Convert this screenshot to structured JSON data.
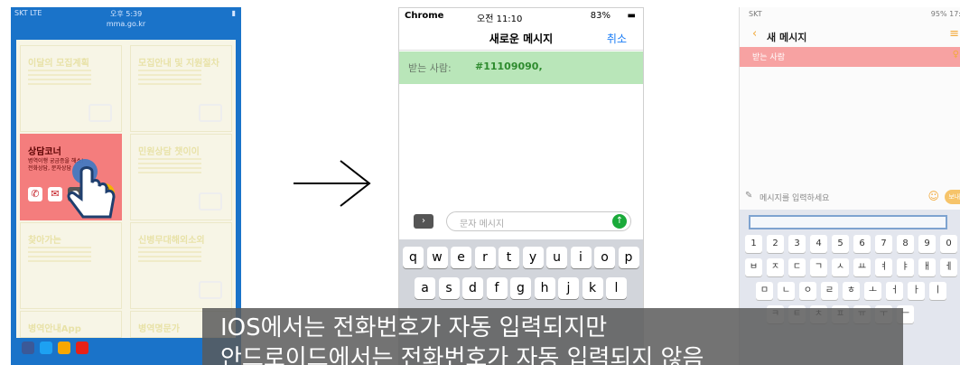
{
  "phone1": {
    "status_carrier": "SKT LTE",
    "status_time": "오후 5:39",
    "url": "mma.go.kr",
    "tiles": [
      {
        "title": "이달의 모집계획"
      },
      {
        "title": "모집안내 및 지원절차"
      },
      {
        "title": "상담코너",
        "desc1": "병역이행 궁금증을 해소!",
        "desc2": "전화상담, 문자상담"
      },
      {
        "title": "민원상담 챗이이"
      },
      {
        "title": "찾아가는"
      },
      {
        "title": "신병무대해외소외"
      },
      {
        "title": "병역안내App"
      },
      {
        "title": "병역명문가"
      }
    ]
  },
  "phone2": {
    "status_left": "Chrome",
    "status_time": "오전 11:10",
    "status_battery": "83%",
    "nav_title": "새로운 메시지",
    "cancel_label": "취소",
    "recipient_label": "받는 사람:",
    "recipient_number": "#11109090,",
    "message_placeholder": "문자 메시지",
    "keyboard_row1": [
      "q",
      "w",
      "e",
      "r",
      "t",
      "y",
      "u",
      "i",
      "o",
      "p"
    ],
    "keyboard_row2": [
      "a",
      "s",
      "d",
      "f",
      "g",
      "h",
      "j",
      "k",
      "l"
    ]
  },
  "phone3": {
    "status_left": "SKT",
    "status_right": "95% 17:",
    "title": "새 메시지",
    "recipient_label": "받는 사람",
    "input_placeholder": "메시지를 입력하세요",
    "send_label": "보내기",
    "num_row": [
      "1",
      "2",
      "3",
      "4",
      "5",
      "6",
      "7",
      "8",
      "9",
      "0"
    ],
    "row2": [
      "ㅂ",
      "ㅈ",
      "ㄷ",
      "ㄱ",
      "ㅅ",
      "ㅛ",
      "ㅕ",
      "ㅑ",
      "ㅐ",
      "ㅔ"
    ],
    "row3": [
      "ㅁ",
      "ㄴ",
      "ㅇ",
      "ㄹ",
      "ㅎ",
      "ㅗ",
      "ㅓ",
      "ㅏ",
      "ㅣ"
    ],
    "row4": [
      "ㅋ",
      "ㅌ",
      "ㅊ",
      "ㅍ",
      "ㅠ",
      "ㅜ",
      "ㅡ"
    ]
  },
  "caption": {
    "line1": "IOS에서는 전화번호가 자동 입력되지만",
    "line2": "안드로이드에서는 전화번호가 자동 입력되지 않음"
  },
  "colors": {
    "phone1_bg": "#1a73c9",
    "hot_tile": "#f47d7d",
    "ios_recipient": "#b9e6b9",
    "android_recipient": "#f7a2a2",
    "android_accent": "#f2a93b"
  }
}
